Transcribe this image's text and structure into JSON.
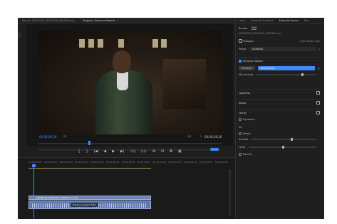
{
  "tabs": [
    {
      "label": "Source: 20002220_20002220_CS0000.mov",
      "active": false
    },
    {
      "label": "Program: Enhance Speech",
      "active": true
    }
  ],
  "program": {
    "timecode_left": "00;00;36;28",
    "fit": "Fit",
    "page": "1/2",
    "timecode_right": "00;00;28;16"
  },
  "transport": {
    "buttons": [
      "{",
      "}",
      "|◀",
      "◀",
      "▶",
      "▶|",
      "◁◁",
      "▷▷",
      "⊞",
      "⊟",
      "⧉",
      "▣"
    ]
  },
  "timeline": {
    "ruler": [
      "00;00;00;00",
      "00;00;04;00",
      "00;00;08;00",
      "00;00;12;00",
      "00;00;16;00",
      "00;00;20;00",
      "00;00;24;00",
      "00;00;28;00",
      "00;00;32;00",
      "00;00;36;00",
      "00;00;40;00",
      "00;00;44;00",
      "00;00;48;00"
    ],
    "video_clip": "20002220_20002220_CS0000.mov [V]",
    "audio_badge": "Enhance Speech",
    "audio_badge_value": "50%"
  },
  "right": {
    "tabs": [
      {
        "label": "Learn",
        "active": false
      },
      {
        "label": "Essential Graphics",
        "active": false
      },
      {
        "label": "Essential Sound",
        "active": true
      },
      {
        "label": "Text",
        "active": false
      }
    ],
    "subtabs": [
      "Browse",
      "Edit"
    ],
    "clip_name": "20002220_20002220_CS0000.mov",
    "dialogue": "Dialogue",
    "clear_audio_type": "Clear Audio Type",
    "preset_label": "Preset",
    "preset_value": "(Custom)",
    "enhance_speech": "Enhance Speech",
    "enhance_btn": "Enhance",
    "mix_amount": "Mix Amount",
    "re_enhance": "Re-Enhance",
    "loudness": "Loudness",
    "repair": "Repair",
    "clarity": "Clarity",
    "dynamics": "Dynamics",
    "eq": "EQ",
    "preset_small": "Preset",
    "amount": "Amount",
    "level": "Level",
    "reverb": "Reverb"
  }
}
